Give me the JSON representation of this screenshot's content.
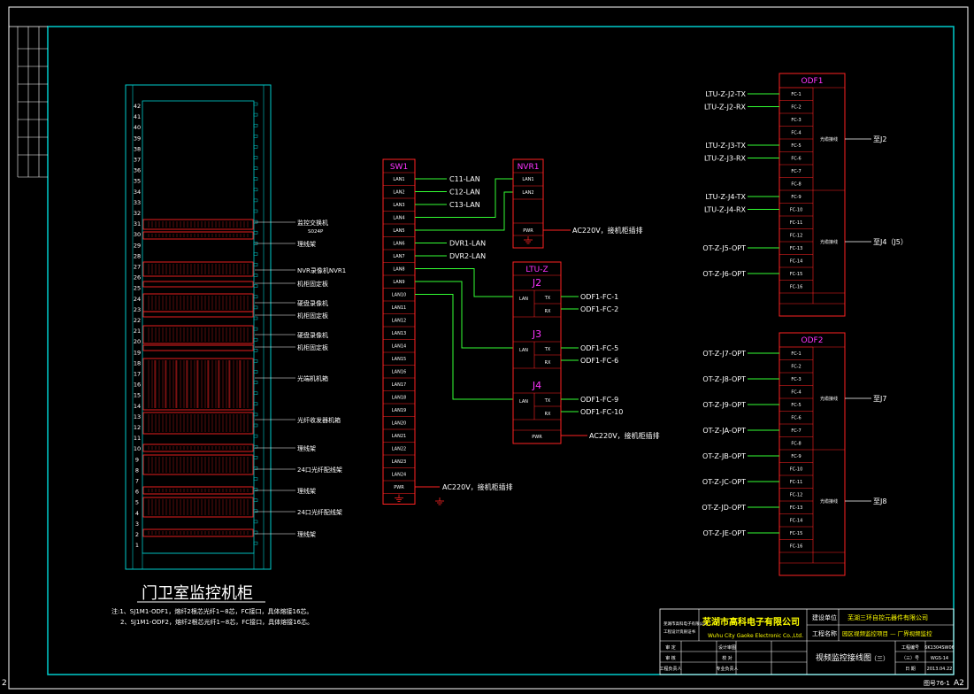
{
  "sheet": {
    "left_edge_label": "2",
    "bottom_right_label": "A2",
    "drawing_number_label": "图号76-1"
  },
  "cabinet": {
    "title": "门卫室监控机柜",
    "u_numbers": [
      "42",
      "41",
      "40",
      "39",
      "38",
      "37",
      "36",
      "35",
      "34",
      "33",
      "32",
      "31",
      "30",
      "29",
      "28",
      "27",
      "26",
      "25",
      "24",
      "23",
      "22",
      "21",
      "20",
      "19",
      "18",
      "17",
      "16",
      "15",
      "14",
      "13",
      "12",
      "11",
      "10",
      "9",
      "8",
      "7",
      "6",
      "5",
      "4",
      "3",
      "2",
      "1"
    ],
    "equipment_labels": [
      {
        "text": "监控交换机",
        "sub": "S024P"
      },
      {
        "text": "理线架",
        "sub": ""
      },
      {
        "text": "NVR录像机NVR1",
        "sub": ""
      },
      {
        "text": "机柜固定板",
        "sub": ""
      },
      {
        "text": "硬盘录像机",
        "sub": ""
      },
      {
        "text": "机柜固定板",
        "sub": ""
      },
      {
        "text": "硬盘录像机",
        "sub": ""
      },
      {
        "text": "机柜固定板",
        "sub": ""
      },
      {
        "text": "光端机机箱",
        "sub": ""
      },
      {
        "text": "光纤收发器机箱",
        "sub": ""
      },
      {
        "text": "理线架",
        "sub": ""
      },
      {
        "text": "24口光纤配线架",
        "sub": ""
      },
      {
        "text": "理线架",
        "sub": ""
      },
      {
        "text": "24口光纤配线架",
        "sub": ""
      },
      {
        "text": "理线架",
        "sub": ""
      }
    ],
    "notes": [
      "注:1、SJ1M1-ODF1，熔纤2根芯光纤1~8芯，FC接口，具体熔接16芯。",
      "2、SJ1M1-ODF2，熔纤2根芯光纤1~8芯，FC接口，具体熔接16芯。"
    ]
  },
  "sw1": {
    "title": "SW1",
    "ports": [
      "LAN1",
      "LAN2",
      "LAN3",
      "LAN4",
      "LAN5",
      "LAN6",
      "LAN7",
      "LAN8",
      "LAN9",
      "LAN10",
      "LAN11",
      "LAN12",
      "LAN13",
      "LAN14",
      "LAN15",
      "LAN16",
      "LAN17",
      "LAN18",
      "LAN19",
      "LAN20",
      "LAN21",
      "LAN22",
      "LAN23",
      "LAN24",
      "PWR"
    ],
    "connections": [
      "C11-LAN",
      "C12-LAN",
      "C13-LAN",
      "DVR1-LAN",
      "DVR2-LAN"
    ],
    "power": "AC220V，接机柜插排"
  },
  "nvr1": {
    "title": "NVR1",
    "ports": [
      "LAN1",
      "LAN2",
      "PWR"
    ],
    "power": "AC220V，接机柜插排"
  },
  "ltu": {
    "title": "LTU-Z",
    "groups": [
      {
        "name": "J2",
        "lan": "LAN",
        "tx": "TX",
        "rx": "RX",
        "tx_to": "ODF1-FC-1",
        "rx_to": "ODF1-FC-2"
      },
      {
        "name": "J3",
        "lan": "LAN",
        "tx": "TX",
        "rx": "RX",
        "tx_to": "ODF1-FC-5",
        "rx_to": "ODF1-FC-6"
      },
      {
        "name": "J4",
        "lan": "LAN",
        "tx": "TX",
        "rx": "RX",
        "tx_to": "ODF1-FC-9",
        "rx_to": "ODF1-FC-10"
      }
    ],
    "pwr": "PWR",
    "power": "AC220V，接机柜插排"
  },
  "odf1": {
    "title": "ODF1",
    "ports": [
      "FC-1",
      "FC-2",
      "FC-3",
      "FC-4",
      "FC-5",
      "FC-6",
      "FC-7",
      "FC-8",
      "FC-9",
      "FC-10",
      "FC-11",
      "FC-12",
      "FC-13",
      "FC-14",
      "FC-15",
      "FC-16"
    ],
    "inputs": [
      "LTU-Z-J2-TX",
      "LTU-Z-J2-RX",
      "LTU-Z-J3-TX",
      "LTU-Z-J3-RX",
      "LTU-Z-J4-TX",
      "LTU-Z-J4-RX",
      "OT-Z-J5-OPT",
      "OT-Z-J6-OPT"
    ],
    "cable_label": "光缆接线",
    "to": [
      "至J2",
      "至J4（J5）"
    ]
  },
  "odf2": {
    "title": "ODF2",
    "ports": [
      "FC-1",
      "FC-2",
      "FC-3",
      "FC-4",
      "FC-5",
      "FC-6",
      "FC-7",
      "FC-8",
      "FC-9",
      "FC-10",
      "FC-11",
      "FC-12",
      "FC-13",
      "FC-14",
      "FC-15",
      "FC-16"
    ],
    "inputs": [
      "OT-Z-J7-OPT",
      "OT-Z-J8-OPT",
      "OT-Z-J9-OPT",
      "OT-Z-JA-OPT",
      "OT-Z-JB-OPT",
      "OT-Z-JC-OPT",
      "OT-Z-JD-OPT",
      "OT-Z-JE-OPT"
    ],
    "cable_label": "光缆接线",
    "to": [
      "至J7",
      "至J8"
    ]
  },
  "title_block": {
    "company_cn": "芜湖市高科电子有限公司",
    "company_en": "Wuhu City Gaoke Electronic Co.,Ltd.",
    "small_left": [
      "芜湖市高科电子有限公司",
      "工程设计资质证书"
    ],
    "build_unit_label": "建设单位",
    "build_unit": "芜湖三环自控元器件有限公司",
    "project_label": "工程名称",
    "project": "园区视频监控项目 — 厂界视频监控",
    "drawing_title": "视频监控接线图",
    "rows_left": [
      [
        "审  定",
        "",
        "设计审图",
        ""
      ],
      [
        "审  核",
        "",
        "校  对",
        ""
      ],
      [
        "工程负责人",
        "",
        "专业负责人",
        ""
      ]
    ],
    "right_cells": [
      [
        "工程编号",
        "6K1304SW06"
      ],
      [
        "（三）号",
        "WGS-14"
      ],
      [
        "日  期",
        "2013.04.22"
      ]
    ],
    "stage": "（三）"
  }
}
